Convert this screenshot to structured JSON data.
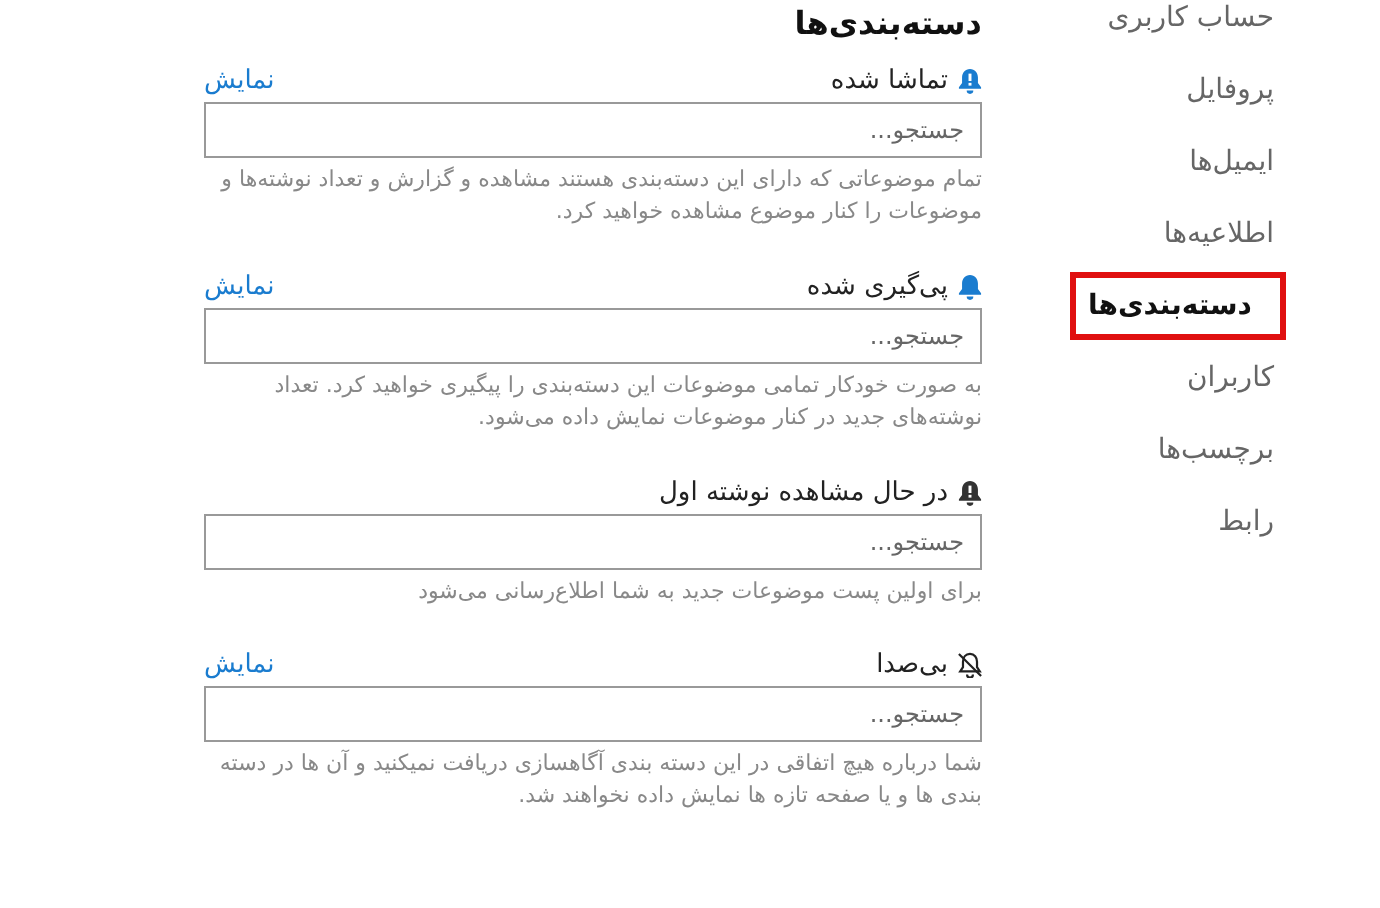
{
  "sidebar": {
    "items": [
      {
        "label": "حساب کاربری",
        "selected": false
      },
      {
        "label": "پروفایل",
        "selected": false
      },
      {
        "label": "ایمیل‌ها",
        "selected": false
      },
      {
        "label": "اطلاعیه‌ها",
        "selected": false
      },
      {
        "label": "دسته‌بندی‌ها",
        "selected": true
      },
      {
        "label": "کاربران",
        "selected": false
      },
      {
        "label": "برچسب‌ها",
        "selected": false
      },
      {
        "label": "رابط",
        "selected": false
      }
    ]
  },
  "title": "دسته‌بندی‌ها",
  "sections": [
    {
      "kind": "watching",
      "label": "تماشا شده",
      "link": "نمایش",
      "placeholder": "جستجو...",
      "help": "تمام موضوعاتی که دارای این دسته‌بندی هستند مشاهده و گزارش و تعداد نوشته‌ها و موضوعات را کنار موضوع مشاهده خواهید کرد."
    },
    {
      "kind": "tracking",
      "label": "پی‌گیری شده",
      "link": "نمایش",
      "placeholder": "جستجو...",
      "help": "به صورت خودکار تمامی موضوعات این دسته‌بندی را پیگیری خواهید کرد. تعداد نوشته‌های جدید در کنار موضوعات نمایش داده می‌شود."
    },
    {
      "kind": "watching_first",
      "label": "در حال مشاهده نوشته اول",
      "placeholder": "جستجو...",
      "help": "برای اولین پست موضوعات جدید به شما اطلاع‌رسانی می‌شود"
    },
    {
      "kind": "muted",
      "label": "بی‌صدا",
      "link": "نمایش",
      "placeholder": "جستجو...",
      "help": "شما درباره هیچ اتفاقی در این دسته بندی آگاهسازی دریافت نمیکنید و آن ها در دسته بندی ها و یا صفحه تازه ها نمایش داده نخواهند شد."
    }
  ]
}
